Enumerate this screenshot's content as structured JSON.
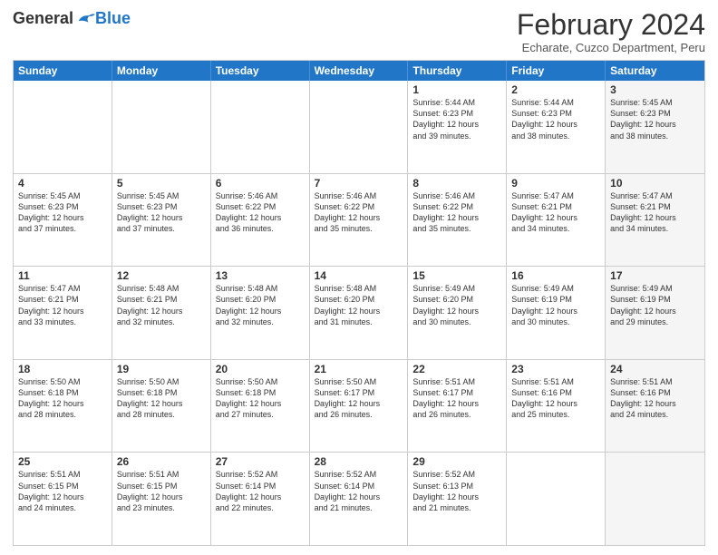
{
  "logo": {
    "general": "General",
    "blue": "Blue"
  },
  "title": "February 2024",
  "subtitle": "Echarate, Cuzco Department, Peru",
  "header_days": [
    "Sunday",
    "Monday",
    "Tuesday",
    "Wednesday",
    "Thursday",
    "Friday",
    "Saturday"
  ],
  "weeks": [
    [
      {
        "day": "",
        "info": "",
        "shaded": false
      },
      {
        "day": "",
        "info": "",
        "shaded": false
      },
      {
        "day": "",
        "info": "",
        "shaded": false
      },
      {
        "day": "",
        "info": "",
        "shaded": false
      },
      {
        "day": "1",
        "info": "Sunrise: 5:44 AM\nSunset: 6:23 PM\nDaylight: 12 hours\nand 39 minutes.",
        "shaded": false
      },
      {
        "day": "2",
        "info": "Sunrise: 5:44 AM\nSunset: 6:23 PM\nDaylight: 12 hours\nand 38 minutes.",
        "shaded": false
      },
      {
        "day": "3",
        "info": "Sunrise: 5:45 AM\nSunset: 6:23 PM\nDaylight: 12 hours\nand 38 minutes.",
        "shaded": true
      }
    ],
    [
      {
        "day": "4",
        "info": "Sunrise: 5:45 AM\nSunset: 6:23 PM\nDaylight: 12 hours\nand 37 minutes.",
        "shaded": false
      },
      {
        "day": "5",
        "info": "Sunrise: 5:45 AM\nSunset: 6:23 PM\nDaylight: 12 hours\nand 37 minutes.",
        "shaded": false
      },
      {
        "day": "6",
        "info": "Sunrise: 5:46 AM\nSunset: 6:22 PM\nDaylight: 12 hours\nand 36 minutes.",
        "shaded": false
      },
      {
        "day": "7",
        "info": "Sunrise: 5:46 AM\nSunset: 6:22 PM\nDaylight: 12 hours\nand 35 minutes.",
        "shaded": false
      },
      {
        "day": "8",
        "info": "Sunrise: 5:46 AM\nSunset: 6:22 PM\nDaylight: 12 hours\nand 35 minutes.",
        "shaded": false
      },
      {
        "day": "9",
        "info": "Sunrise: 5:47 AM\nSunset: 6:21 PM\nDaylight: 12 hours\nand 34 minutes.",
        "shaded": false
      },
      {
        "day": "10",
        "info": "Sunrise: 5:47 AM\nSunset: 6:21 PM\nDaylight: 12 hours\nand 34 minutes.",
        "shaded": true
      }
    ],
    [
      {
        "day": "11",
        "info": "Sunrise: 5:47 AM\nSunset: 6:21 PM\nDaylight: 12 hours\nand 33 minutes.",
        "shaded": false
      },
      {
        "day": "12",
        "info": "Sunrise: 5:48 AM\nSunset: 6:21 PM\nDaylight: 12 hours\nand 32 minutes.",
        "shaded": false
      },
      {
        "day": "13",
        "info": "Sunrise: 5:48 AM\nSunset: 6:20 PM\nDaylight: 12 hours\nand 32 minutes.",
        "shaded": false
      },
      {
        "day": "14",
        "info": "Sunrise: 5:48 AM\nSunset: 6:20 PM\nDaylight: 12 hours\nand 31 minutes.",
        "shaded": false
      },
      {
        "day": "15",
        "info": "Sunrise: 5:49 AM\nSunset: 6:20 PM\nDaylight: 12 hours\nand 30 minutes.",
        "shaded": false
      },
      {
        "day": "16",
        "info": "Sunrise: 5:49 AM\nSunset: 6:19 PM\nDaylight: 12 hours\nand 30 minutes.",
        "shaded": false
      },
      {
        "day": "17",
        "info": "Sunrise: 5:49 AM\nSunset: 6:19 PM\nDaylight: 12 hours\nand 29 minutes.",
        "shaded": true
      }
    ],
    [
      {
        "day": "18",
        "info": "Sunrise: 5:50 AM\nSunset: 6:18 PM\nDaylight: 12 hours\nand 28 minutes.",
        "shaded": false
      },
      {
        "day": "19",
        "info": "Sunrise: 5:50 AM\nSunset: 6:18 PM\nDaylight: 12 hours\nand 28 minutes.",
        "shaded": false
      },
      {
        "day": "20",
        "info": "Sunrise: 5:50 AM\nSunset: 6:18 PM\nDaylight: 12 hours\nand 27 minutes.",
        "shaded": false
      },
      {
        "day": "21",
        "info": "Sunrise: 5:50 AM\nSunset: 6:17 PM\nDaylight: 12 hours\nand 26 minutes.",
        "shaded": false
      },
      {
        "day": "22",
        "info": "Sunrise: 5:51 AM\nSunset: 6:17 PM\nDaylight: 12 hours\nand 26 minutes.",
        "shaded": false
      },
      {
        "day": "23",
        "info": "Sunrise: 5:51 AM\nSunset: 6:16 PM\nDaylight: 12 hours\nand 25 minutes.",
        "shaded": false
      },
      {
        "day": "24",
        "info": "Sunrise: 5:51 AM\nSunset: 6:16 PM\nDaylight: 12 hours\nand 24 minutes.",
        "shaded": true
      }
    ],
    [
      {
        "day": "25",
        "info": "Sunrise: 5:51 AM\nSunset: 6:15 PM\nDaylight: 12 hours\nand 24 minutes.",
        "shaded": false
      },
      {
        "day": "26",
        "info": "Sunrise: 5:51 AM\nSunset: 6:15 PM\nDaylight: 12 hours\nand 23 minutes.",
        "shaded": false
      },
      {
        "day": "27",
        "info": "Sunrise: 5:52 AM\nSunset: 6:14 PM\nDaylight: 12 hours\nand 22 minutes.",
        "shaded": false
      },
      {
        "day": "28",
        "info": "Sunrise: 5:52 AM\nSunset: 6:14 PM\nDaylight: 12 hours\nand 21 minutes.",
        "shaded": false
      },
      {
        "day": "29",
        "info": "Sunrise: 5:52 AM\nSunset: 6:13 PM\nDaylight: 12 hours\nand 21 minutes.",
        "shaded": false
      },
      {
        "day": "",
        "info": "",
        "shaded": false
      },
      {
        "day": "",
        "info": "",
        "shaded": true
      }
    ]
  ]
}
